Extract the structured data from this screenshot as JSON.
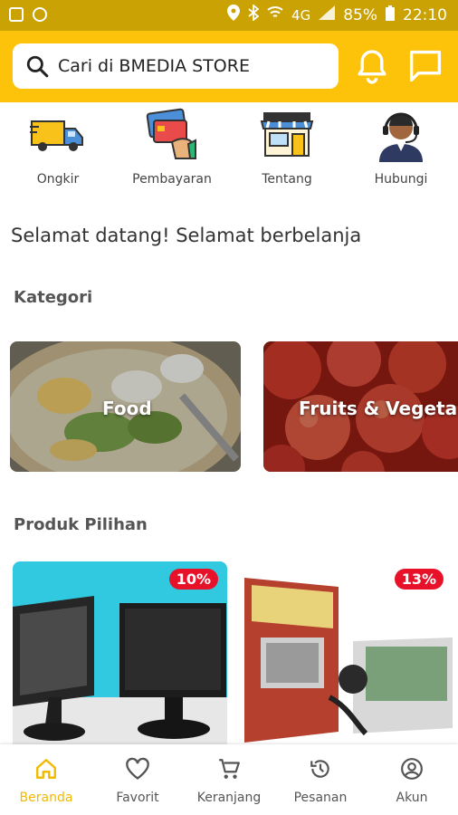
{
  "status_bar": {
    "battery": "85%",
    "time": "22:10",
    "network": "4G"
  },
  "header": {
    "search_placeholder": "Cari di BMEDIA STORE",
    "icons": {
      "search": "search-icon",
      "notification": "bell-icon",
      "chat": "chat-icon"
    }
  },
  "quick_menu": [
    {
      "label": "Ongkir",
      "icon": "delivery-truck-icon"
    },
    {
      "label": "Pembayaran",
      "icon": "card-payment-icon"
    },
    {
      "label": "Tentang",
      "icon": "store-icon"
    },
    {
      "label": "Hubungi",
      "icon": "customer-service-icon"
    }
  ],
  "welcome_text": "Selamat datang! Selamat berbelanja",
  "categories": {
    "title": "Kategori",
    "items": [
      {
        "label": "Food"
      },
      {
        "label": "Fruits & Vegetables"
      }
    ]
  },
  "featured": {
    "title": "Produk Pilihan",
    "items": [
      {
        "discount": "10%",
        "image": "monitors-photo"
      },
      {
        "discount": "13%",
        "image": "power-supply-photo"
      }
    ]
  },
  "bottom_nav": [
    {
      "label": "Beranda",
      "icon": "home-icon",
      "active": true
    },
    {
      "label": "Favorit",
      "icon": "heart-icon",
      "active": false
    },
    {
      "label": "Keranjang",
      "icon": "cart-icon",
      "active": false
    },
    {
      "label": "Pesanan",
      "icon": "history-icon",
      "active": false
    },
    {
      "label": "Akun",
      "icon": "account-icon",
      "active": false
    }
  ],
  "colors": {
    "primary": "#fcc30a",
    "status_bar": "#caa203",
    "badge": "#e8112a",
    "active_nav": "#f1b900"
  }
}
